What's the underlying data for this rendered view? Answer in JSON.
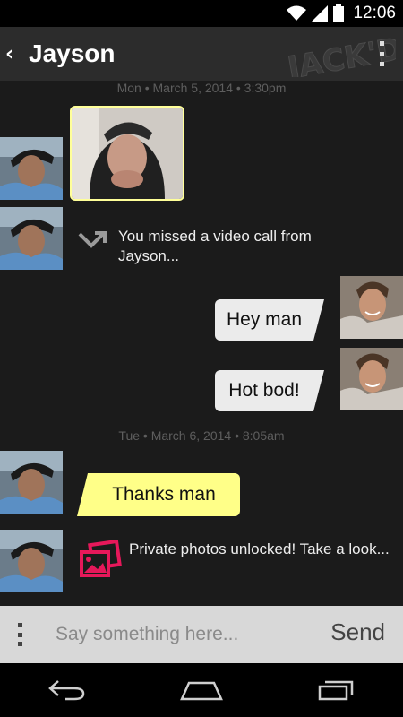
{
  "status_bar": {
    "time": "12:06"
  },
  "header": {
    "contact_name": "Jayson",
    "back_glyph": "‹",
    "logo_text": "JACK'D"
  },
  "chat": {
    "date1": "Mon • March 5, 2014 • 3:30pm",
    "missed_call": "You missed a video call from Jayson...",
    "out_msgs": [
      "Hey man",
      "Hot bod!"
    ],
    "date2": "Tue • March 6, 2014 • 8:05am",
    "in_msg": "Thanks man",
    "private_photos": "Private photos unlocked! Take a look..."
  },
  "compose": {
    "placeholder": "Say something here...",
    "send_label": "Send"
  },
  "icons": {
    "wifi": "wifi-icon",
    "signal": "cell-signal-icon",
    "battery": "battery-icon",
    "back": "chevron-left-icon",
    "overflow": "overflow-menu-icon",
    "missed_call": "missed-call-icon",
    "private_photos": "photos-icon",
    "nav_back": "nav-back-icon",
    "nav_home": "nav-home-icon",
    "nav_recents": "nav-recents-icon"
  },
  "colors": {
    "accent_yellow": "#ffff88",
    "bubble_gray": "#ebebeb",
    "private_pink": "#e6185a",
    "background": "#1b1b1b"
  }
}
